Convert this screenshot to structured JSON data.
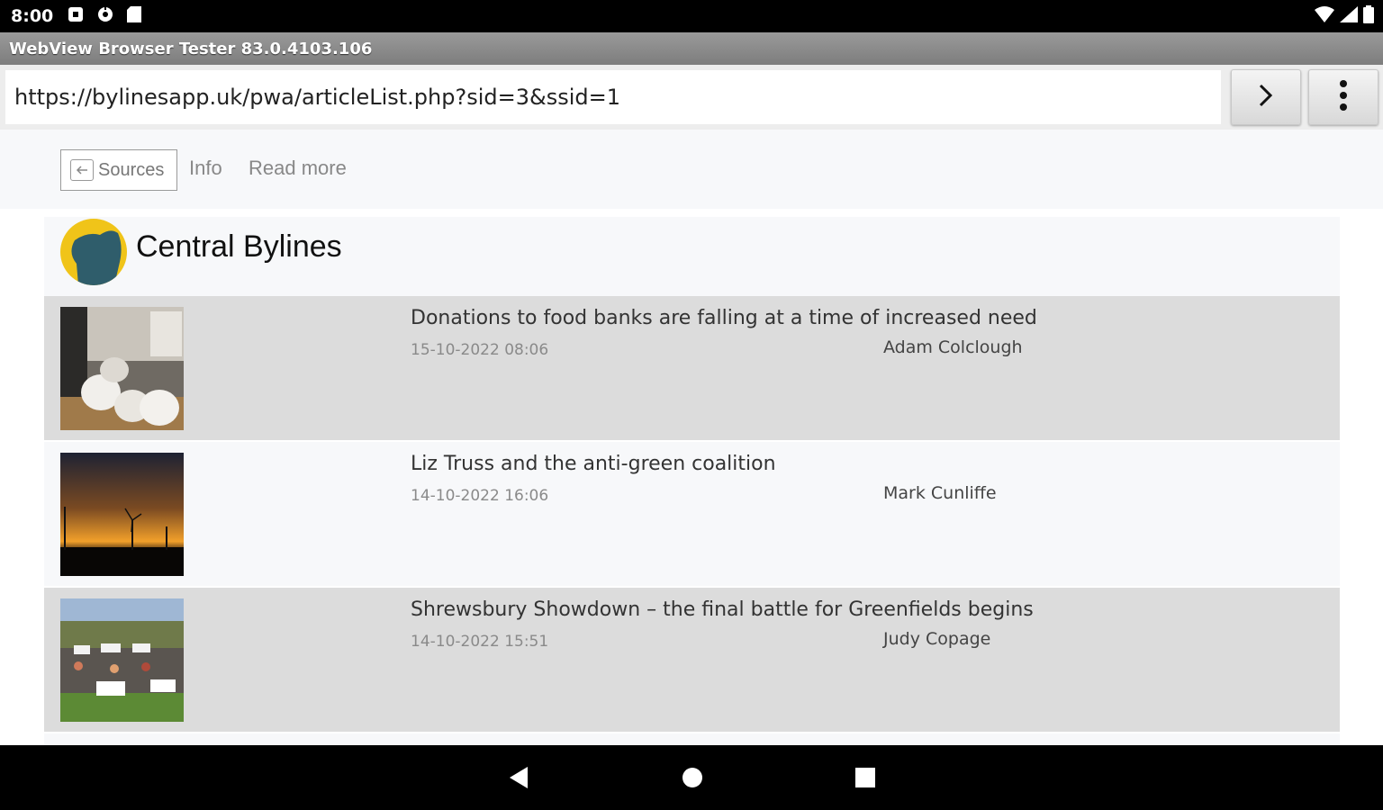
{
  "status_bar": {
    "time": "8:00",
    "icons": [
      "notification-square-icon",
      "settings-gear-icon",
      "sd-card-icon"
    ],
    "right_icons": [
      "wifi-icon",
      "cell-signal-icon",
      "battery-icon"
    ]
  },
  "window": {
    "title": "WebView Browser Tester 83.0.4103.106"
  },
  "url_bar": {
    "url": "https://bylinesapp.uk/pwa/articleList.php?sid=3&ssid=1",
    "go_icon": "chevron-right-icon",
    "menu_icon": "more-vert-icon"
  },
  "nav": {
    "sources_label": "Sources",
    "info_label": "Info",
    "read_more_label": "Read more"
  },
  "source": {
    "name": "Central Bylines",
    "logo_color": "#f0c419",
    "logo_shape_color": "#2f5d6b"
  },
  "articles": [
    {
      "title": "Donations to food banks are falling at a time of increased need",
      "date": "15-10-2022 08:06",
      "author": "Adam Colclough"
    },
    {
      "title": "Liz Truss and the anti-green coalition",
      "date": "14-10-2022 16:06",
      "author": "Mark Cunliffe"
    },
    {
      "title": "Shrewsbury Showdown – the final battle for Greenfields begins",
      "date": "14-10-2022 15:51",
      "author": "Judy Copage"
    }
  ],
  "bottom_nav": {
    "icons": [
      "back-triangle-icon",
      "home-circle-icon",
      "recents-square-icon"
    ]
  }
}
